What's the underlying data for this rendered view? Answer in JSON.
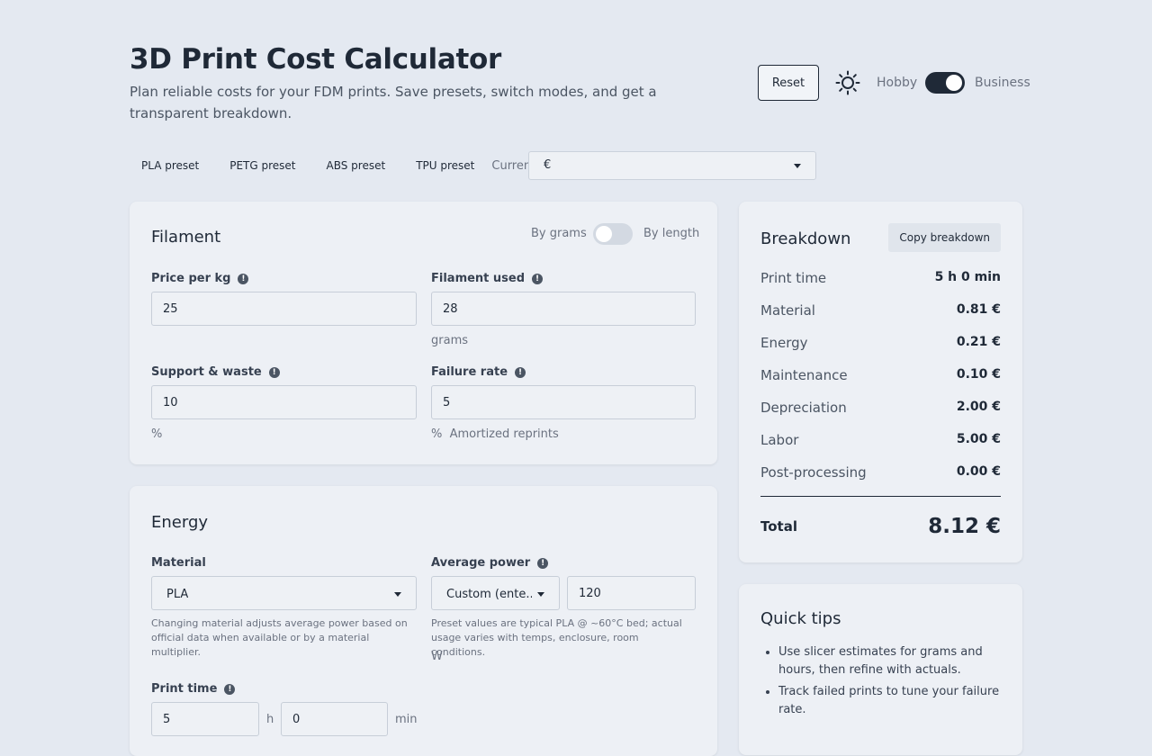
{
  "header": {
    "title": "3D Print Cost Calculator",
    "subtitle": "Plan reliable costs for your FDM prints. Save presets, switch modes, and get a transparent breakdown.",
    "reset_label": "Reset",
    "mode_left": "Hobby",
    "mode_right": "Business",
    "mode_value": "Business"
  },
  "presets": {
    "items": [
      "PLA preset",
      "PETG preset",
      "ABS preset",
      "TPU preset"
    ],
    "currency_label": "Currency:",
    "currency_value": "€"
  },
  "filament": {
    "title": "Filament",
    "toggle_left": "By grams",
    "toggle_right": "By length",
    "price_label": "Price per kg",
    "price_value": "25",
    "used_label": "Filament used",
    "used_value": "28",
    "used_unit": "grams",
    "support_label": "Support & waste",
    "support_value": "10",
    "support_unit": "%",
    "failure_label": "Failure rate",
    "failure_value": "5",
    "failure_unit": "%  Amortized reprints"
  },
  "energy": {
    "title": "Energy",
    "material_label": "Material",
    "material_value": "PLA",
    "material_hint": "Changing material adjusts average power based on official data when available or by a material multiplier.",
    "power_label": "Average power",
    "power_mode": "Custom (ente...",
    "power_value": "120",
    "power_hint": "Preset values are typical PLA @ ~60°C bed; actual usage varies with temps, enclosure, room conditions.",
    "power_unit": "W",
    "time_label": "Print time",
    "hours_value": "5",
    "hours_unit": "h",
    "minutes_value": "0",
    "minutes_unit": "min"
  },
  "breakdown": {
    "title": "Breakdown",
    "copy_label": "Copy breakdown",
    "rows": [
      {
        "label": "Print time",
        "value": "5 h 0 min"
      },
      {
        "label": "Material",
        "value": "0.81 €"
      },
      {
        "label": "Energy",
        "value": "0.21 €"
      },
      {
        "label": "Maintenance",
        "value": "0.10 €"
      },
      {
        "label": "Depreciation",
        "value": "2.00 €"
      },
      {
        "label": "Labor",
        "value": "5.00 €"
      },
      {
        "label": "Post-processing",
        "value": "0.00 €"
      }
    ],
    "total_label": "Total",
    "total_value": "8.12 €"
  },
  "tips": {
    "title": "Quick tips",
    "items": [
      "Use slicer estimates for grams and hours, then refine with actuals.",
      "Track failed prints to tune your failure rate."
    ]
  }
}
